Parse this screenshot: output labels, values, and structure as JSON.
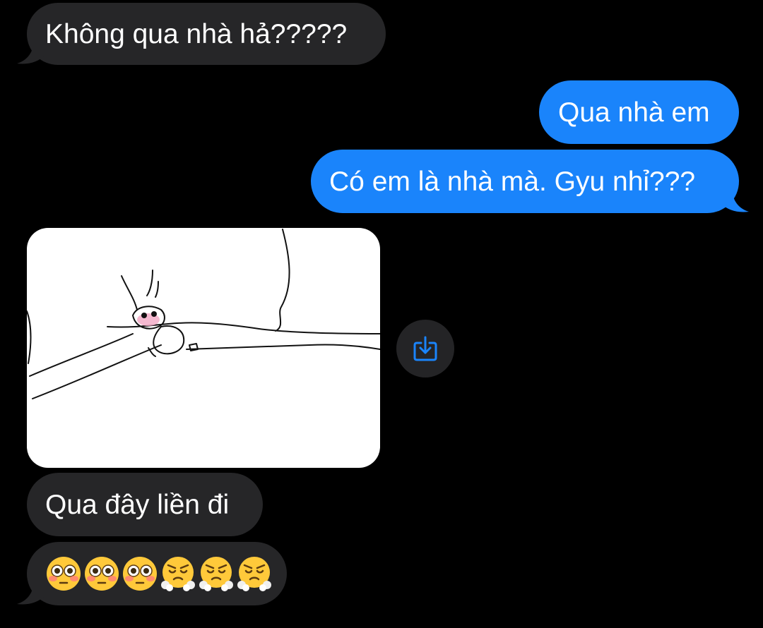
{
  "conversation": {
    "messages": [
      {
        "sender": "them",
        "text": "Không qua nhà hả?????"
      },
      {
        "sender": "me",
        "text": "Qua nhà em"
      },
      {
        "sender": "me",
        "text": "Có em là nhà mà. Gyu nhỉ???"
      },
      {
        "sender": "them",
        "type": "image",
        "description": "drawing"
      },
      {
        "sender": "them",
        "text": "Qua đây liền đi"
      },
      {
        "sender": "them",
        "type": "emoji",
        "emojis": [
          "flushed-face",
          "flushed-face",
          "flushed-face",
          "face-with-steam-from-nose",
          "face-with-steam-from-nose",
          "face-with-steam-from-nose"
        ]
      }
    ]
  },
  "colors": {
    "background": "#000000",
    "incoming_bubble": "#262628",
    "outgoing_bubble": "#1a84fb",
    "text": "#ffffff",
    "save_icon": "#1a84fb"
  },
  "icons": {
    "save": "save-to-device-icon"
  }
}
